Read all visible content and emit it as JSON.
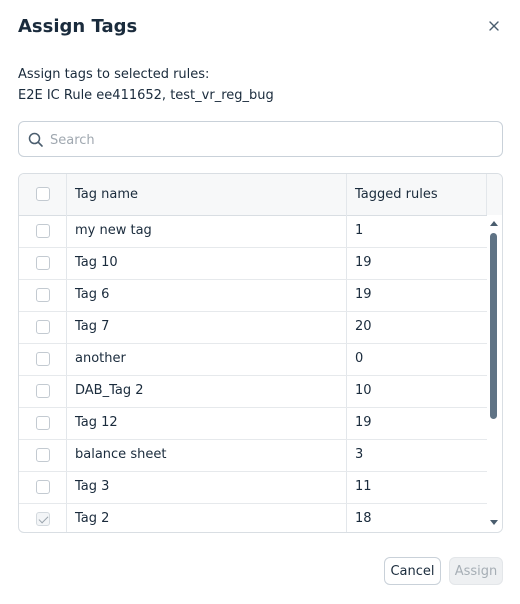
{
  "dialog": {
    "title": "Assign Tags",
    "subtitle": "Assign tags to selected rules:",
    "selected_rules": "E2E IC Rule ee411652, test_vr_reg_bug"
  },
  "search": {
    "placeholder": "Search",
    "value": ""
  },
  "table": {
    "columns": {
      "name": "Tag name",
      "count": "Tagged rules"
    },
    "rows": [
      {
        "name": "my new tag",
        "count": "1",
        "checked": false
      },
      {
        "name": "Tag 10",
        "count": "19",
        "checked": false
      },
      {
        "name": "Tag 6",
        "count": "19",
        "checked": false
      },
      {
        "name": "Tag 7",
        "count": "20",
        "checked": false
      },
      {
        "name": "another",
        "count": "0",
        "checked": false
      },
      {
        "name": "DAB_Tag 2",
        "count": "10",
        "checked": false
      },
      {
        "name": "Tag 12",
        "count": "19",
        "checked": false
      },
      {
        "name": "balance sheet",
        "count": "3",
        "checked": false
      },
      {
        "name": "Tag 3",
        "count": "11",
        "checked": false
      },
      {
        "name": "Tag 2",
        "count": "18",
        "checked": true
      }
    ]
  },
  "footer": {
    "cancel_label": "Cancel",
    "assign_label": "Assign"
  },
  "icons": {
    "close": "close-icon",
    "search": "search-icon"
  }
}
